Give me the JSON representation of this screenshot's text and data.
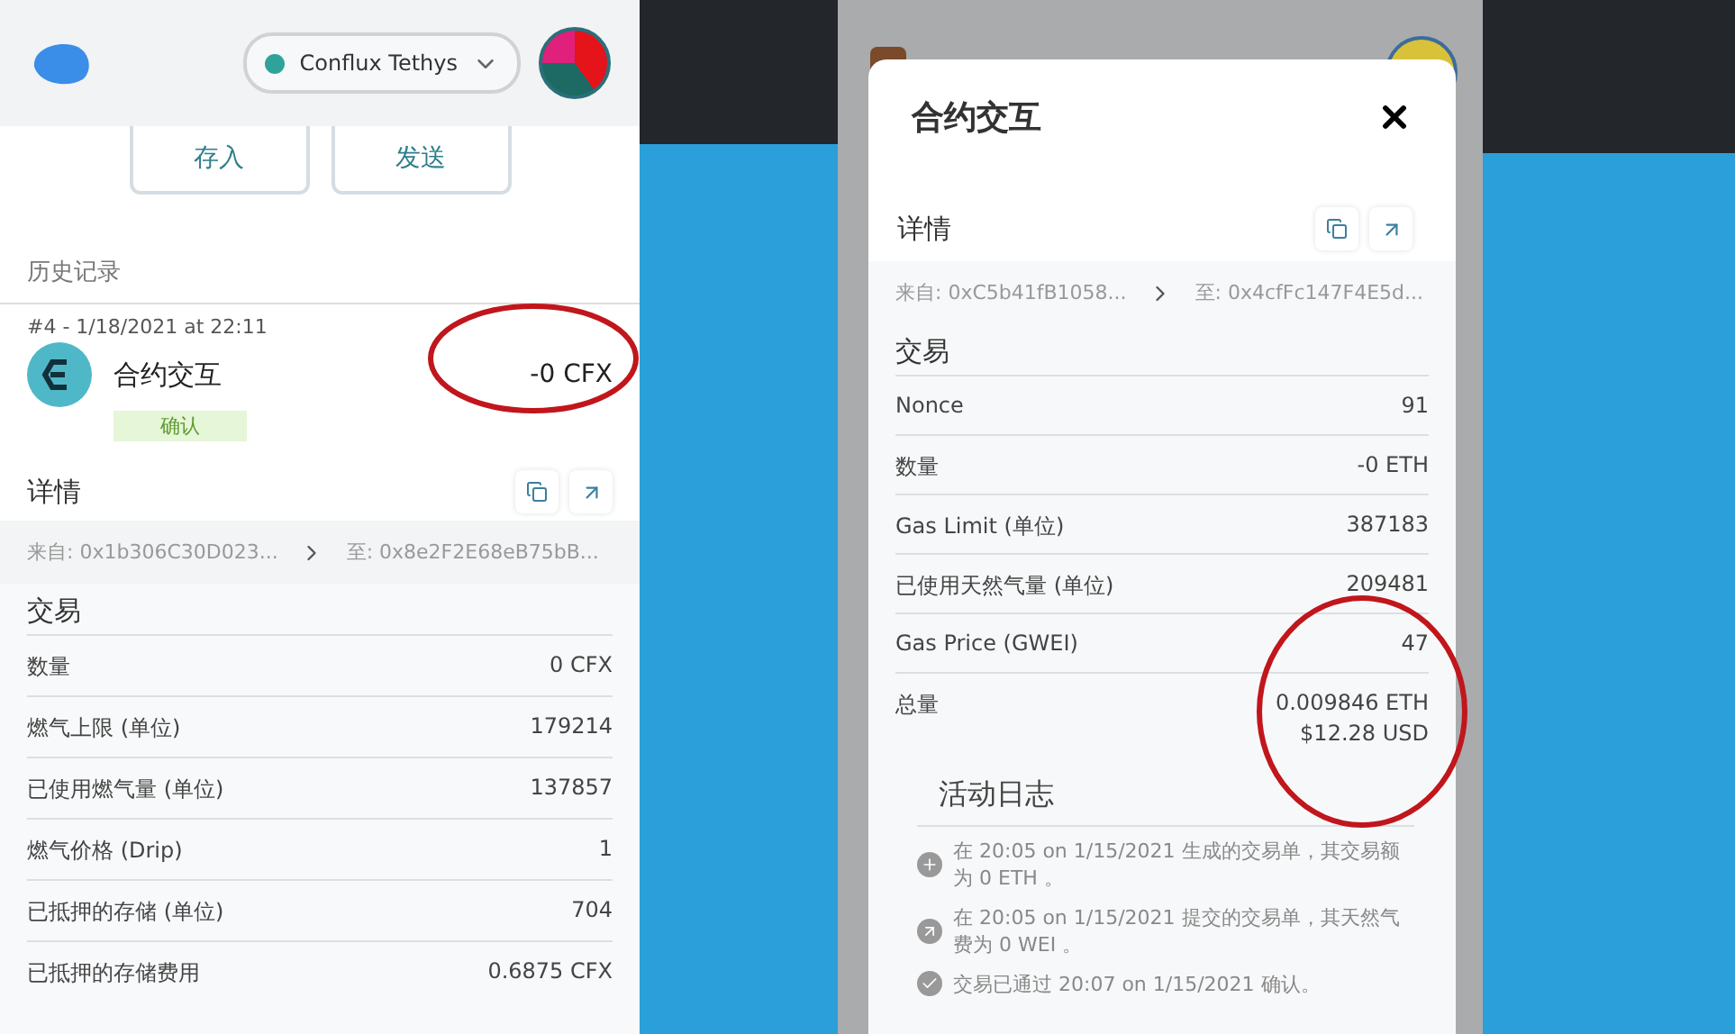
{
  "portal": {
    "network": {
      "name": "Conflux Tethys",
      "color": "#2fa39a"
    },
    "actions": [
      "存入",
      "发送"
    ],
    "history_title": "历史记录",
    "transaction": {
      "meta": "#4 - 1/18/2021 at 22:11",
      "title": "合约交互",
      "amount": "-0 CFX",
      "status": "确认"
    },
    "details": {
      "title": "详情",
      "from": "来自: 0x1b306C30D023...",
      "to": "至: 0x8e2F2E68eB75bB..."
    },
    "section": "交易",
    "rows": [
      {
        "label": "数量",
        "value": "0 CFX"
      },
      {
        "label": "燃气上限 (单位)",
        "value": "179214"
      },
      {
        "label": "已使用燃气量 (单位)",
        "value": "137857"
      },
      {
        "label": "燃气价格 (Drip)",
        "value": "1"
      },
      {
        "label": "已抵押的存储 (单位)",
        "value": "704"
      },
      {
        "label": "已抵押的存储费用",
        "value": "0.6875 CFX"
      }
    ]
  },
  "metamask": {
    "dialog_title": "合约交互",
    "details": {
      "title": "详情",
      "from": "来自: 0xC5b41fB1058...",
      "to": "至: 0x4cfFc147F4E5d..."
    },
    "section": "交易",
    "rows": [
      {
        "label": "Nonce",
        "value": "91"
      },
      {
        "label": "数量",
        "value": "-0 ETH"
      },
      {
        "label": "Gas Limit (单位)",
        "value": "387183"
      },
      {
        "label": "已使用天然气量 (单位)",
        "value": "209481"
      },
      {
        "label": "Gas Price (GWEI)",
        "value": "47"
      }
    ],
    "total": {
      "label": "总量",
      "values": [
        "0.009846 ETH",
        "$12.28 USD"
      ]
    },
    "activity": {
      "title": "活动日志",
      "entries": [
        {
          "kind": "created",
          "text": "在 20:05 on 1/15/2021 生成的交易单，其交易额为 0 ETH 。"
        },
        {
          "kind": "submitted",
          "text": "在 20:05 on 1/15/2021 提交的交易单，其天然气费为 0 WEI 。"
        },
        {
          "kind": "confirmed",
          "text": "交易已通过 20:07 on 1/15/2021 确认。"
        }
      ]
    }
  }
}
